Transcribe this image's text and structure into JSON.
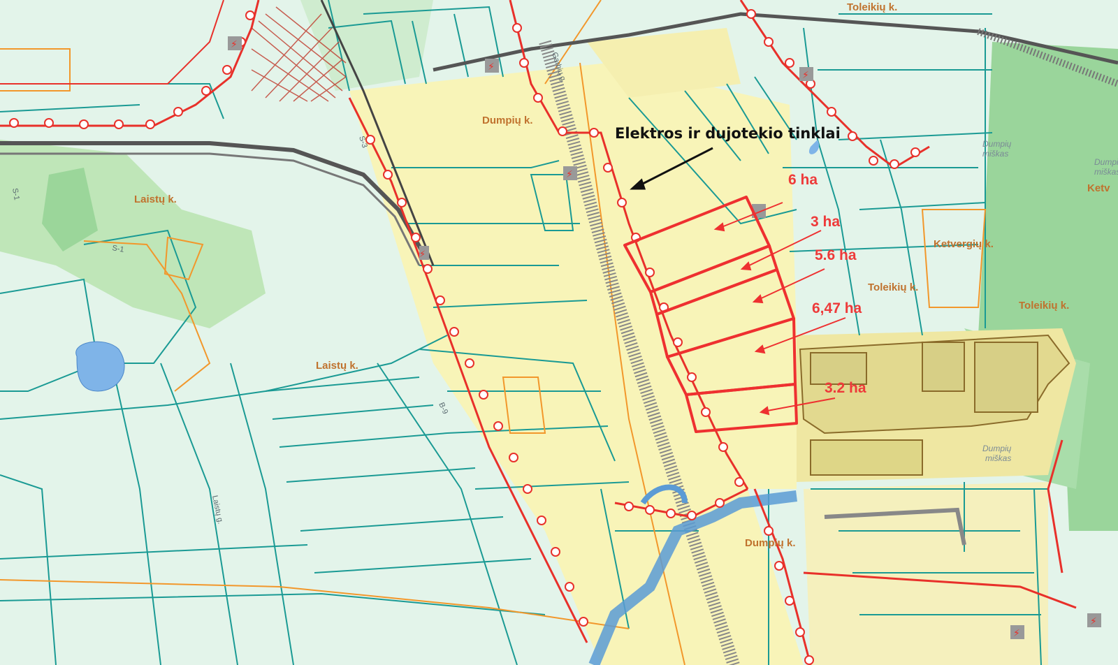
{
  "places": [
    {
      "id": "toleikiu-top",
      "text": "Toleikių k."
    },
    {
      "id": "dumpiu-upper",
      "text": "Dumpių k."
    },
    {
      "id": "laistu-upper",
      "text": "Laistų k."
    },
    {
      "id": "laistu-lower",
      "text": "Laistų k."
    },
    {
      "id": "ketvergiu",
      "text": "Ketvergių k."
    },
    {
      "id": "toleikiu-mid",
      "text": "Toleikių k."
    },
    {
      "id": "toleikiu-right",
      "text": "Toleikių k."
    },
    {
      "id": "dumpiu-lower",
      "text": "Dumpių k."
    },
    {
      "id": "ketv-edge",
      "text": "Ketv"
    }
  ],
  "forest_labels": [
    {
      "id": "forest-1-line1",
      "text": "Dumpių"
    },
    {
      "id": "forest-1-line2",
      "text": "miškas"
    },
    {
      "id": "forest-2-line1",
      "text": "Dumpių"
    },
    {
      "id": "forest-2-line2",
      "text": "miškas"
    },
    {
      "id": "forest-3-line1",
      "text": "Dumpi"
    },
    {
      "id": "forest-3-line2",
      "text": "miškas"
    }
  ],
  "road_labels": [
    {
      "id": "road-s1",
      "text": "S-1"
    },
    {
      "id": "road-s1-b",
      "text": "S-1"
    },
    {
      "id": "road-laistu-g",
      "text": "Laistų g."
    },
    {
      "id": "road-s3",
      "text": "S-3"
    },
    {
      "id": "road-garb",
      "text": "Garbių g."
    },
    {
      "id": "road-b",
      "text": "B-9"
    }
  ],
  "annotation": {
    "label": "Elektros ir dujotekio tinklai"
  },
  "parcels": [
    {
      "id": "parcel-1",
      "area": "6 ha"
    },
    {
      "id": "parcel-2",
      "area": "3 ha"
    },
    {
      "id": "parcel-3",
      "area": "5.6 ha"
    },
    {
      "id": "parcel-4",
      "area": "6,47 ha"
    },
    {
      "id": "parcel-5",
      "area": "3.2 ha"
    }
  ],
  "colors": {
    "parcel_outline": "#ee3030",
    "parcel_boundary": "#138f8a",
    "power_line": "#e8302a",
    "water": "#5b9bd5",
    "forest": "#8fd18f",
    "zone_fill": "#f7f3b4"
  },
  "icons": [
    "power-station-icon"
  ]
}
